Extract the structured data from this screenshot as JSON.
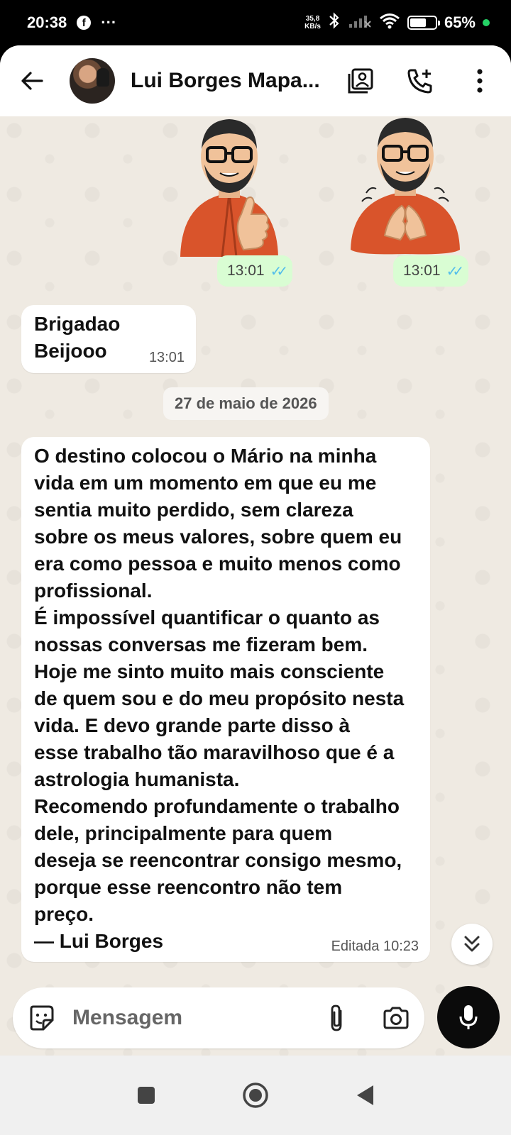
{
  "status_bar": {
    "time": "20:38",
    "facebook_glyph": "f",
    "more_dots": "···",
    "net_speed_value": "35,8",
    "net_speed_unit": "KB/s",
    "battery_percent": "65%",
    "battery_level": 0.65,
    "icons": [
      "facebook-icon",
      "bluetooth-icon",
      "signal-icon",
      "wifi-icon",
      "battery-icon"
    ]
  },
  "header": {
    "contact_name": "Lui Borges Mapa...",
    "icons": [
      "back-arrow-icon",
      "contact-card-icon",
      "add-call-icon",
      "more-vertical-icon"
    ]
  },
  "messages": {
    "sticker_1_time": "13:01",
    "sticker_2_time": "13:01",
    "reply_text": "Brigadao\nBeijooo",
    "reply_time": "13:01",
    "date_separator": "27 de maio de 2026",
    "testimonial_text": "O destino colocou o Mário na minha\nvida em um momento em que eu me\nsentia muito perdido, sem clareza\nsobre os meus valores, sobre quem eu\nera como pessoa e muito menos como\nprofissional.\nÉ impossível quantificar o quanto as\nnossas conversas me fizeram bem.\nHoje me sinto muito mais consciente\nde quem sou e do meu propósito nesta\nvida. E devo grande parte disso à\nesse trabalho tão maravilhoso que é a\nastrologia humanista.\nRecomendo profundamente o trabalho\ndele, principalmente para quem\ndeseja se reencontrar consigo mesmo,\nporque esse reencontro não tem\npreço.\n— Lui Borges",
    "testimonial_meta": "Editada 10:23",
    "read_ticks": "✓✓"
  },
  "composer": {
    "placeholder": "Mensagem",
    "icons": [
      "sticker-icon",
      "attach-icon",
      "camera-icon",
      "mic-icon"
    ]
  },
  "colors": {
    "chat_background": "#efeae2",
    "outgoing_bubble": "#d9fdd3",
    "incoming_bubble": "#ffffff",
    "read_tick": "#53bdeb",
    "sticker_jacket": "#d9542b"
  }
}
